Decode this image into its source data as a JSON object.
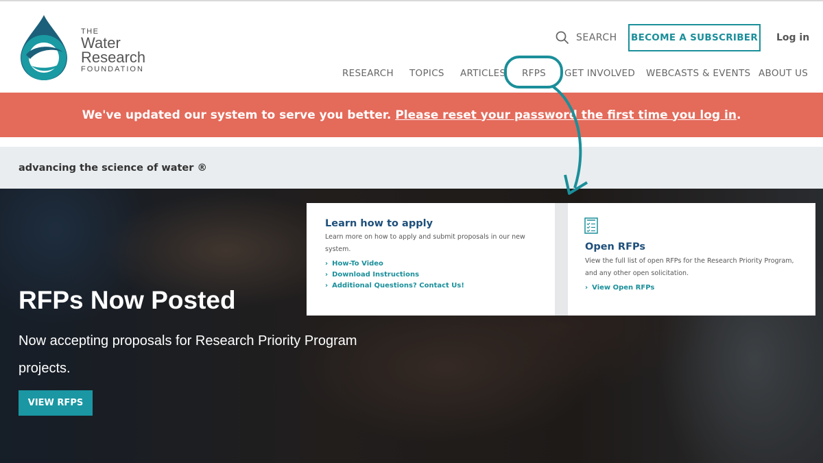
{
  "logo": {
    "line1": "THE",
    "line2": "Water",
    "line3": "Research",
    "line4": "FOUNDATION"
  },
  "header": {
    "search_label": "SEARCH",
    "subscribe_label": "BECOME A SUBSCRIBER",
    "login_label": "Log in"
  },
  "nav": {
    "items": [
      "RESEARCH",
      "TOPICS",
      "ARTICLES",
      "RFPS",
      "GET INVOLVED",
      "WEBCASTS & EVENTS",
      "ABOUT US"
    ]
  },
  "alert": {
    "text": "We've updated our system to serve you better.",
    "link": "Please reset your password the first time you log in",
    "end": "."
  },
  "tagline": "advancing the science of water ®",
  "hero": {
    "title": "RFPs Now Posted",
    "subtitle": "Now accepting proposals for Research Priority Program projects.",
    "button": "VIEW RFPS"
  },
  "apply_card": {
    "title": "Learn how to apply",
    "desc": "Learn more on how to apply and submit proposals in our new system.",
    "links": [
      "How-To Video",
      "Download Instructions",
      "Additional Questions? Contact Us!"
    ]
  },
  "rfp_card": {
    "title": "Open RFPs",
    "desc": "View the full list of open RFPs for the Research Priority Program, and any other open solicitation.",
    "link": "View Open RFPs"
  },
  "colors": {
    "accent": "#1a8f9a",
    "alert_bg": "#e46a5a",
    "card_title": "#1e4f7a"
  },
  "icons": [
    "search-icon",
    "chevron-right-icon",
    "document-list-icon",
    "water-drop-logo"
  ]
}
